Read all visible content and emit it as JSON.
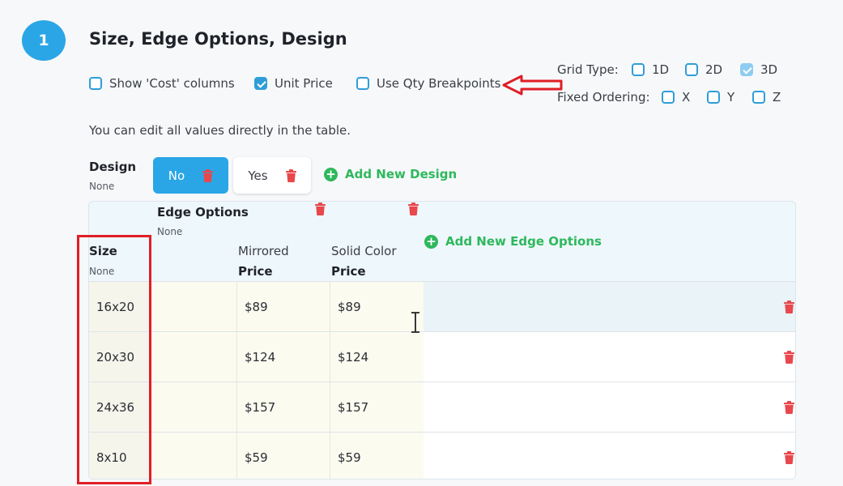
{
  "step": {
    "number": "1",
    "title": "Size, Edge Options, Design"
  },
  "options": {
    "show_cost": {
      "label": "Show 'Cost' columns",
      "checked": false
    },
    "unit_price": {
      "label": "Unit Price",
      "checked": true
    },
    "use_qty": {
      "label": "Use Qty Breakpoints",
      "checked": false
    }
  },
  "grid_type": {
    "label": "Grid Type:",
    "items": [
      {
        "label": "1D",
        "checked": false
      },
      {
        "label": "2D",
        "checked": false
      },
      {
        "label": "3D",
        "checked": true
      }
    ]
  },
  "fixed_ordering": {
    "label": "Fixed Ordering:",
    "items": [
      {
        "label": "X",
        "checked": false
      },
      {
        "label": "Y",
        "checked": false
      },
      {
        "label": "Z",
        "checked": false
      }
    ]
  },
  "info_text": "You can edit all values directly in the table.",
  "design": {
    "label": "Design",
    "sub": "None",
    "buttons": [
      {
        "label": "No",
        "active": true
      },
      {
        "label": "Yes",
        "active": false
      }
    ],
    "add_label": "Add New Design"
  },
  "table": {
    "edge_header": "Edge Options",
    "edge_sub": "None",
    "size_header": "Size",
    "size_sub": "None",
    "columns": [
      {
        "name": "Mirrored",
        "sub": "Price"
      },
      {
        "name": "Solid Color",
        "sub": "Price"
      }
    ],
    "add_edge_label": "Add New Edge Options",
    "rows": [
      {
        "size": "16x20",
        "mirrored": "$89",
        "solid": "$89"
      },
      {
        "size": "20x30",
        "mirrored": "$124",
        "solid": "$124"
      },
      {
        "size": "24x36",
        "mirrored": "$157",
        "solid": "$157"
      },
      {
        "size": "8x10",
        "mirrored": "$59",
        "solid": "$59"
      }
    ]
  },
  "colors": {
    "accent": "#2aa6e6",
    "add_green": "#2eb85c",
    "delete_red": "#e8474c",
    "annotation_red": "#e01e26"
  },
  "icons": [
    "trash-icon",
    "plus-circle-icon",
    "arrow-left-icon",
    "text-cursor-icon"
  ]
}
